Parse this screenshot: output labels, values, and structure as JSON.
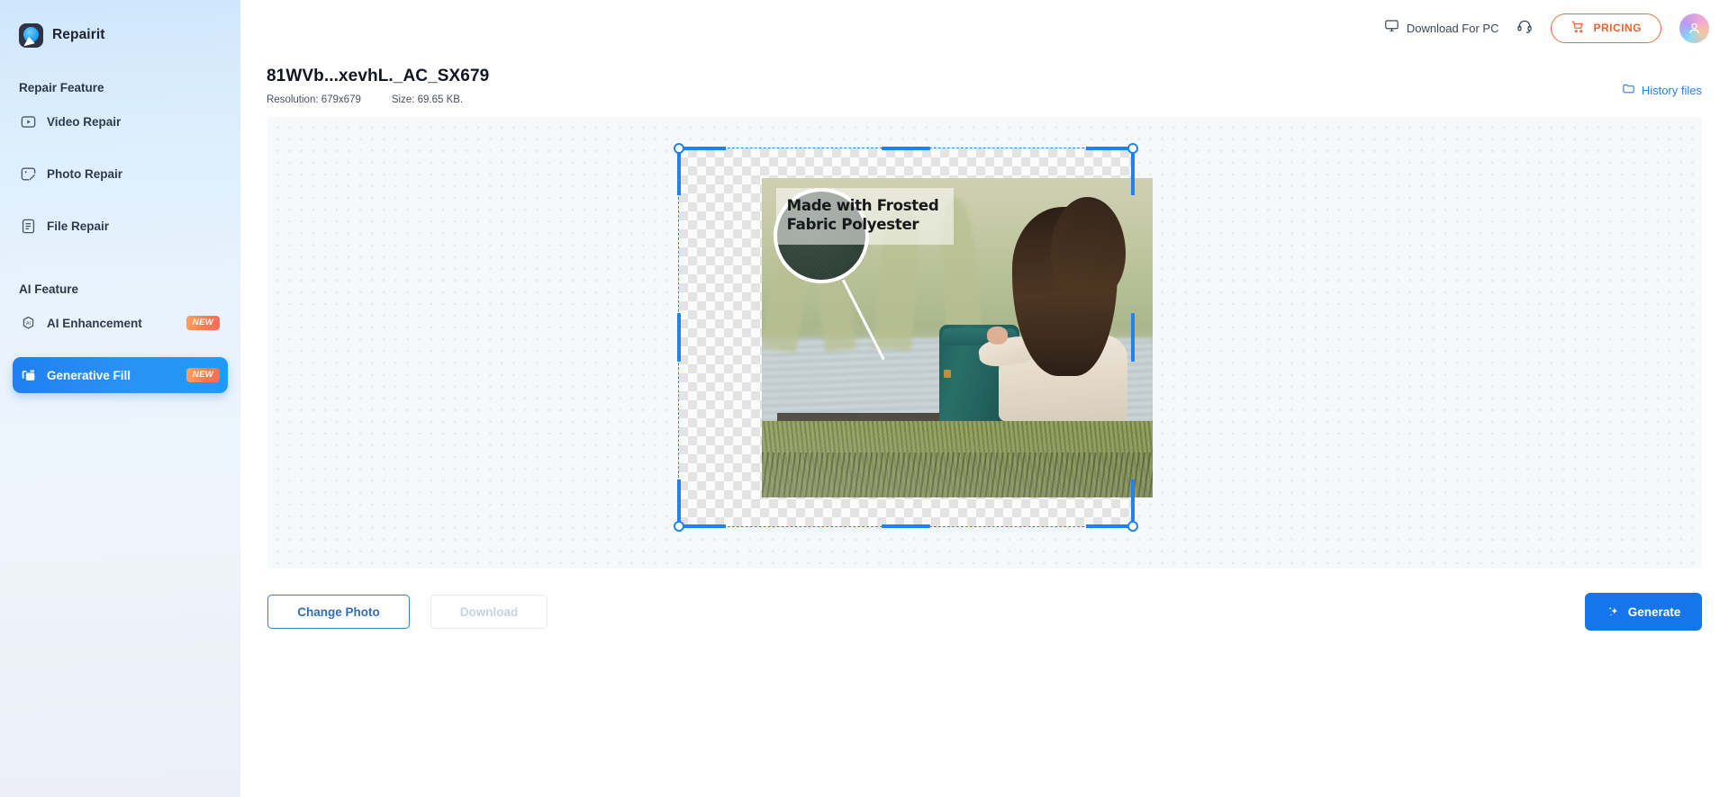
{
  "app": {
    "name": "Repairit",
    "logo_icon": "repairit-logo-icon"
  },
  "sidebar": {
    "groups": [
      {
        "title": "Repair Feature",
        "items": [
          {
            "label": "Video Repair",
            "icon": "video-repair-icon",
            "badge": "",
            "active": false
          },
          {
            "label": "Photo Repair",
            "icon": "photo-repair-icon",
            "badge": "",
            "active": false
          },
          {
            "label": "File Repair",
            "icon": "file-repair-icon",
            "badge": "",
            "active": false
          }
        ]
      },
      {
        "title": "AI Feature",
        "items": [
          {
            "label": "AI Enhancement",
            "icon": "ai-enhancement-icon",
            "badge": "NEW",
            "active": false
          },
          {
            "label": "Generative Fill",
            "icon": "generative-fill-icon",
            "badge": "NEW",
            "active": true
          }
        ]
      }
    ]
  },
  "topbar": {
    "download_for_pc": "Download For PC",
    "download_icon": "monitor-icon",
    "support_icon": "headset-icon",
    "pricing_label": "PRICING",
    "pricing_icon": "cart-icon",
    "avatar_icon": "user-avatar-icon"
  },
  "document": {
    "title": "81WVb...xevhL._AC_SX679",
    "resolution": "Resolution: 679x679",
    "size": "Size: 69.65 KB.",
    "history_label": "History files",
    "history_icon": "folder-icon"
  },
  "canvas": {
    "selection_handles": [
      "top-left",
      "top-center",
      "top-right",
      "middle-left",
      "middle-right",
      "bottom-left",
      "bottom-center",
      "bottom-right"
    ],
    "image": {
      "headline": "Made with Frosted\nFabric Polyester",
      "description": "Woman with long dark hair sitting on a wooden bench by a river, teal backpack beside her, with a circular fabric swatch callout"
    }
  },
  "footer": {
    "change_photo": "Change Photo",
    "download": "Download",
    "generate": "Generate",
    "generate_icon": "magic-wand-icon"
  },
  "colors": {
    "accent_blue": "#1476e8",
    "pricing_orange": "#f05f28",
    "badge_orange": "#fd7b52",
    "selection_blue": "#1f83ef",
    "link_blue": "#2b7fe0"
  }
}
